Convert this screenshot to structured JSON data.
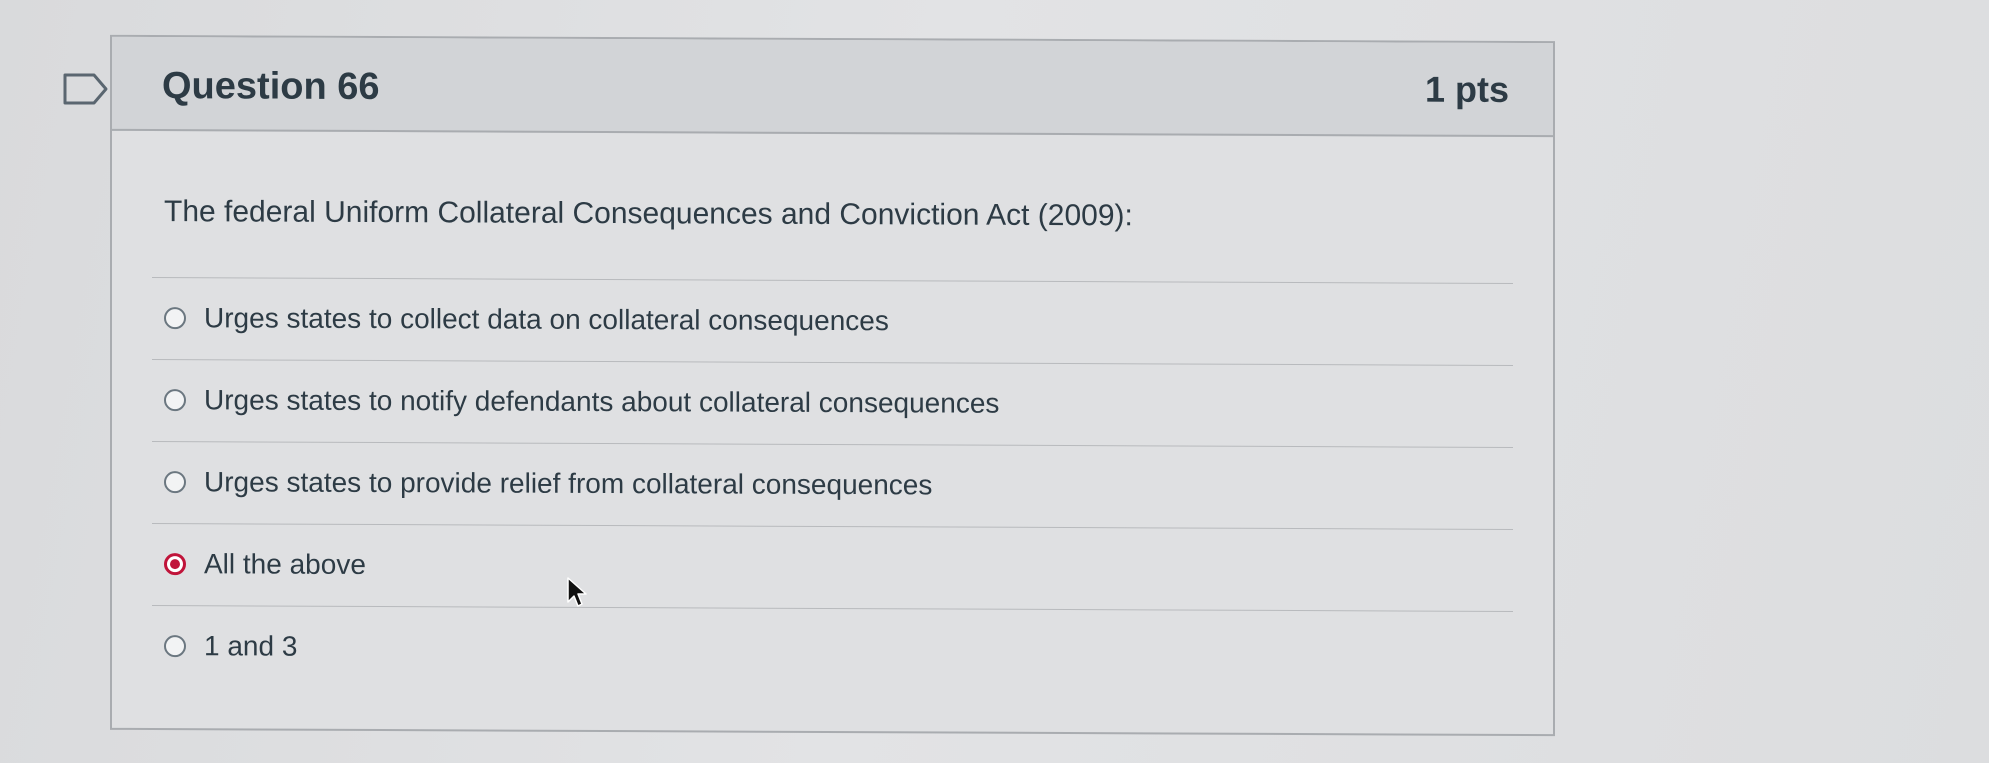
{
  "question": {
    "title": "Question 66",
    "points": "1 pts",
    "text": "The federal Uniform Collateral Consequences and Conviction Act (2009):",
    "flag_icon": "flag-question-icon"
  },
  "answers": [
    {
      "label": "Urges states to collect data on collateral consequences",
      "selected": false
    },
    {
      "label": "Urges states to notify defendants about collateral consequences",
      "selected": false
    },
    {
      "label": "Urges states to provide relief from collateral consequences",
      "selected": false
    },
    {
      "label": "All the above",
      "selected": true
    },
    {
      "label": "1 and 3",
      "selected": false
    }
  ],
  "colors": {
    "selected_radio": "#c0143a",
    "text": "#2d3b45",
    "header_bg": "#d2d4d7"
  }
}
